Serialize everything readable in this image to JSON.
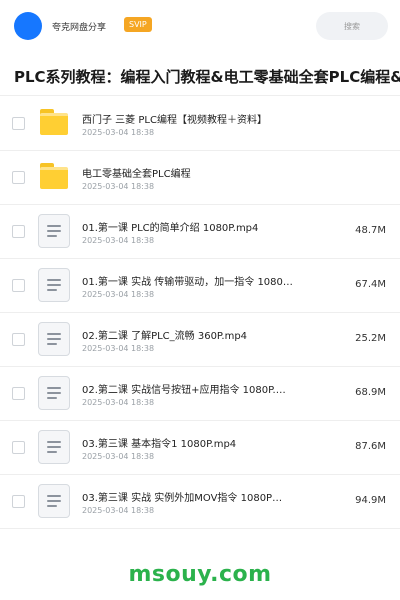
{
  "header": {
    "username": "夸克网盘分享",
    "badge": "SVIP",
    "search_label": "搜索"
  },
  "page": {
    "title": "PLC系列教程：编程入门教程&电工零基础全套PLC编程&三"
  },
  "files": [
    {
      "type": "folder",
      "name": "西门子 三菱 PLC编程【视频教程＋资料】",
      "date": "2025-03-04 18:38",
      "size": ""
    },
    {
      "type": "folder",
      "name": "电工零基础全套PLC编程",
      "date": "2025-03-04 18:38",
      "size": ""
    },
    {
      "type": "file",
      "name": "01.第一课 PLC的简单介绍 1080P.mp4",
      "date": "2025-03-04 18:38",
      "size": "48.7M"
    },
    {
      "type": "file",
      "name": "01.第一课 实战 传输带驱动，加一指令 1080…",
      "date": "2025-03-04 18:38",
      "size": "67.4M"
    },
    {
      "type": "file",
      "name": "02.第二课 了解PLC_流畅 360P.mp4",
      "date": "2025-03-04 18:38",
      "size": "25.2M"
    },
    {
      "type": "file",
      "name": "02.第二课 实战信号按钮+应用指令 1080P.…",
      "date": "2025-03-04 18:38",
      "size": "68.9M"
    },
    {
      "type": "file",
      "name": "03.第三课 基本指令1 1080P.mp4",
      "date": "2025-03-04 18:38",
      "size": "87.6M"
    },
    {
      "type": "file",
      "name": "03.第三课 实战 实例外加MOV指令 1080P…",
      "date": "2025-03-04 18:38",
      "size": "94.9M"
    }
  ],
  "icons": {
    "folder": "folder-icon",
    "file": "document-icon"
  },
  "colors": {
    "avatar": "#1677ff",
    "badge": "#f5a623",
    "folder": "#ffcf33",
    "watermark": "#2bb24c"
  },
  "watermark": "msouy.com"
}
